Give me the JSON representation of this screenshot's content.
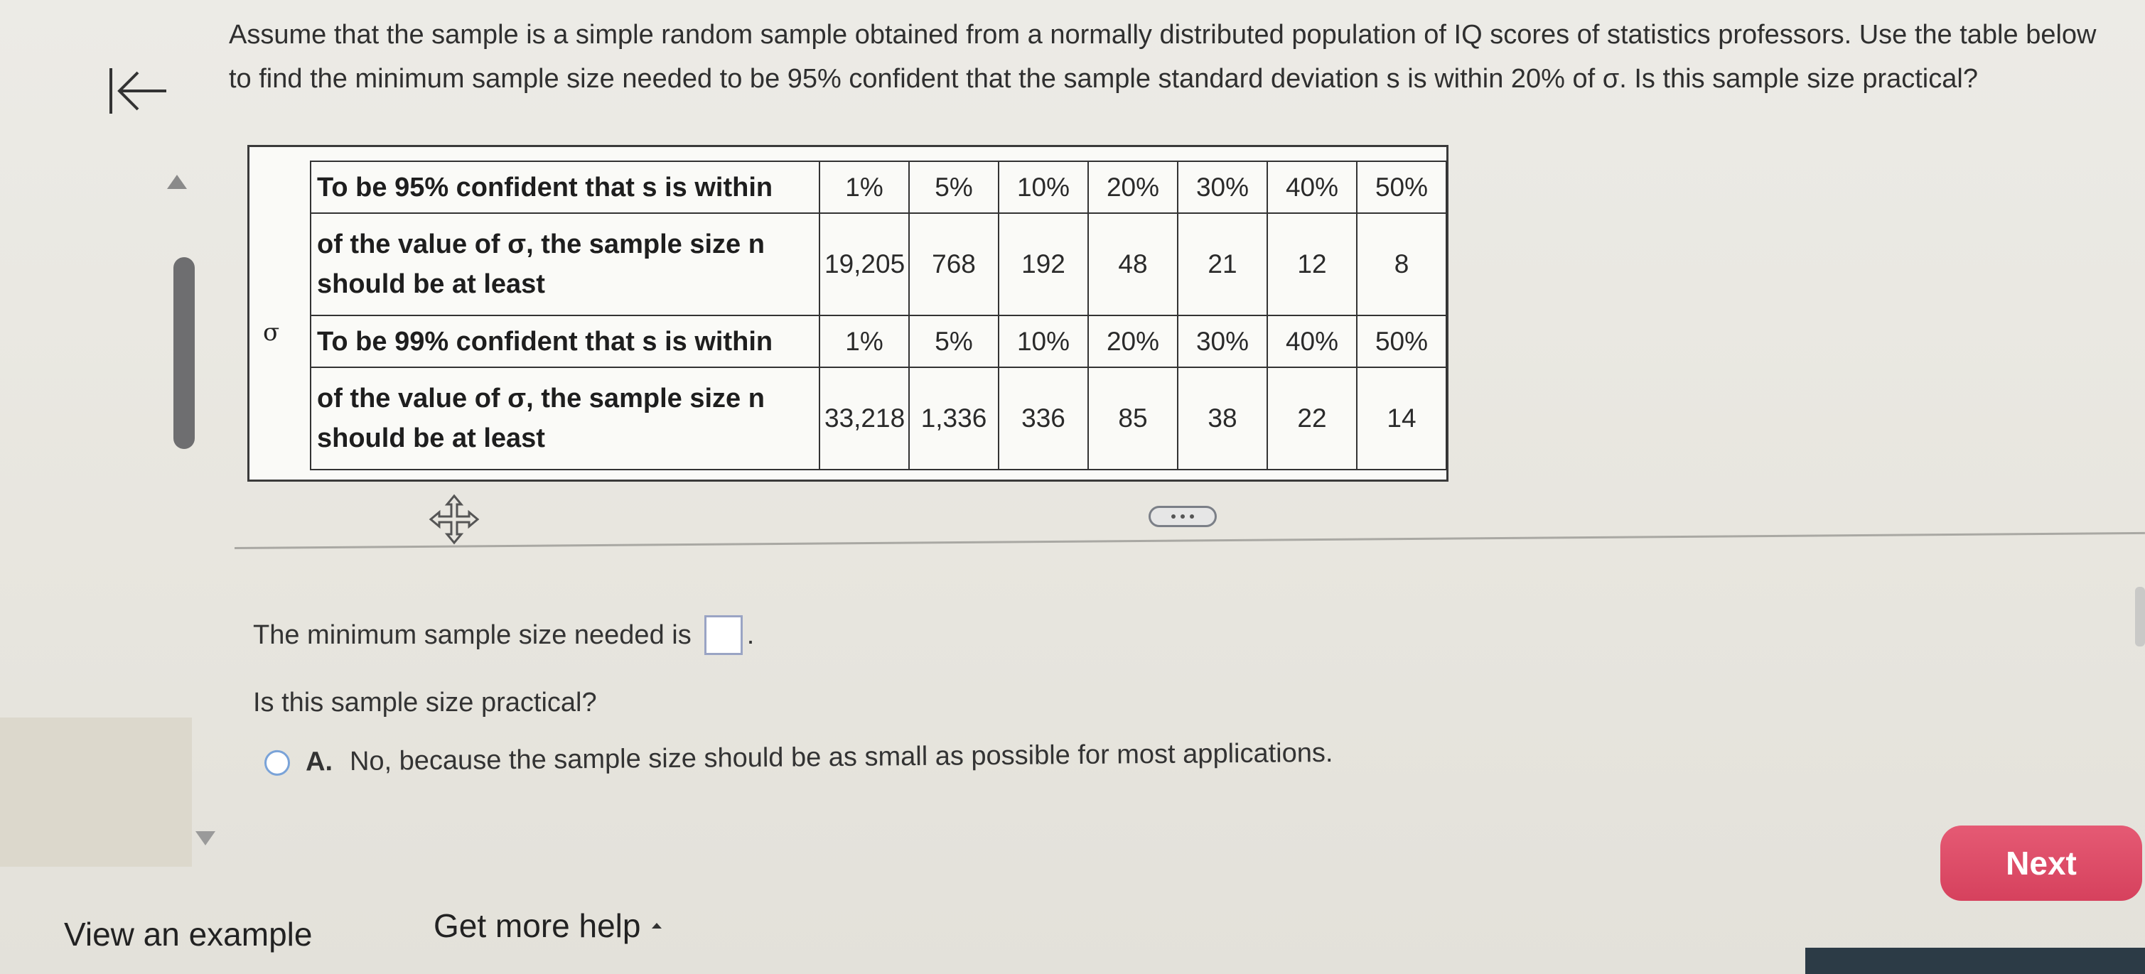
{
  "question": {
    "text": "Assume that the sample is a simple random sample obtained from a normally distributed population of IQ scores of statistics professors. Use the table below to find the minimum sample size needed to be 95% confident that the sample standard deviation s is within 20% of σ. Is this sample size practical?"
  },
  "table": {
    "sigma_symbol": "σ",
    "rows": [
      {
        "label": "To be 95% confident that s is within",
        "values": [
          "1%",
          "5%",
          "10%",
          "20%",
          "30%",
          "40%",
          "50%"
        ]
      },
      {
        "label": "of the value of σ, the sample size n should be at least",
        "values": [
          "19,205",
          "768",
          "192",
          "48",
          "21",
          "12",
          "8"
        ]
      },
      {
        "label": "To be 99% confident that s is within",
        "values": [
          "1%",
          "5%",
          "10%",
          "20%",
          "30%",
          "40%",
          "50%"
        ]
      },
      {
        "label": "of the value of σ, the sample size n should be at least",
        "values": [
          "33,218",
          "1,336",
          "336",
          "85",
          "38",
          "22",
          "14"
        ]
      }
    ]
  },
  "answer": {
    "prefix": "The minimum sample size needed is",
    "suffix": ".",
    "input_value": ""
  },
  "practical_question": "Is this sample size practical?",
  "options": [
    {
      "letter": "A.",
      "text": "No, because the sample size should be as small as possible for most applications."
    }
  ],
  "footer": {
    "view_example": "View an example",
    "get_help": "Get more help",
    "next": "Next"
  },
  "colors": {
    "next_button": "#dc4a66",
    "radio_border": "#7aa3d8",
    "input_border": "#9aa4c4"
  },
  "icons": {
    "back": "arrow-left-to-bar-icon",
    "move": "move-arrows-icon",
    "expand": "ellipsis-icon",
    "help_caret": "caret-up-icon"
  }
}
